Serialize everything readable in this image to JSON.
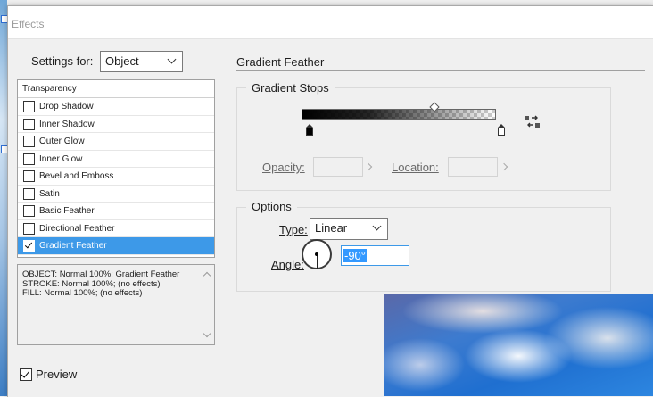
{
  "window": {
    "title": "Effects"
  },
  "settings": {
    "label": "Settings for:",
    "value": "Object"
  },
  "effects_list": {
    "header": "Transparency",
    "items": [
      {
        "label": "Drop Shadow",
        "checked": false
      },
      {
        "label": "Inner Shadow",
        "checked": false
      },
      {
        "label": "Outer Glow",
        "checked": false
      },
      {
        "label": "Inner Glow",
        "checked": false
      },
      {
        "label": "Bevel and Emboss",
        "checked": false
      },
      {
        "label": "Satin",
        "checked": false
      },
      {
        "label": "Basic Feather",
        "checked": false
      },
      {
        "label": "Directional Feather",
        "checked": false
      },
      {
        "label": "Gradient Feather",
        "checked": true,
        "selected": true
      }
    ]
  },
  "summary": {
    "lines": [
      "OBJECT: Normal 100%; Gradient Feather",
      "STROKE: Normal 100%; (no effects)",
      "FILL: Normal 100%; (no effects)"
    ]
  },
  "panel": {
    "title": "Gradient Feather",
    "gradient_stops": {
      "title": "Gradient Stops",
      "opacity_label": "Opacity:",
      "opacity_value": "",
      "location_label": "Location:",
      "location_value": ""
    },
    "options": {
      "title": "Options",
      "type_label": "Type:",
      "type_value": "Linear",
      "angle_label": "Angle:",
      "angle_value": "-90°"
    }
  },
  "preview": {
    "label": "Preview",
    "checked": true
  },
  "icons": {
    "reverse_gradient": "reverse-gradient-icon",
    "angle_dial": "angle-dial-icon"
  },
  "colors": {
    "selection": "#3d99e8",
    "dialog_bg": "#f0f0f0"
  }
}
